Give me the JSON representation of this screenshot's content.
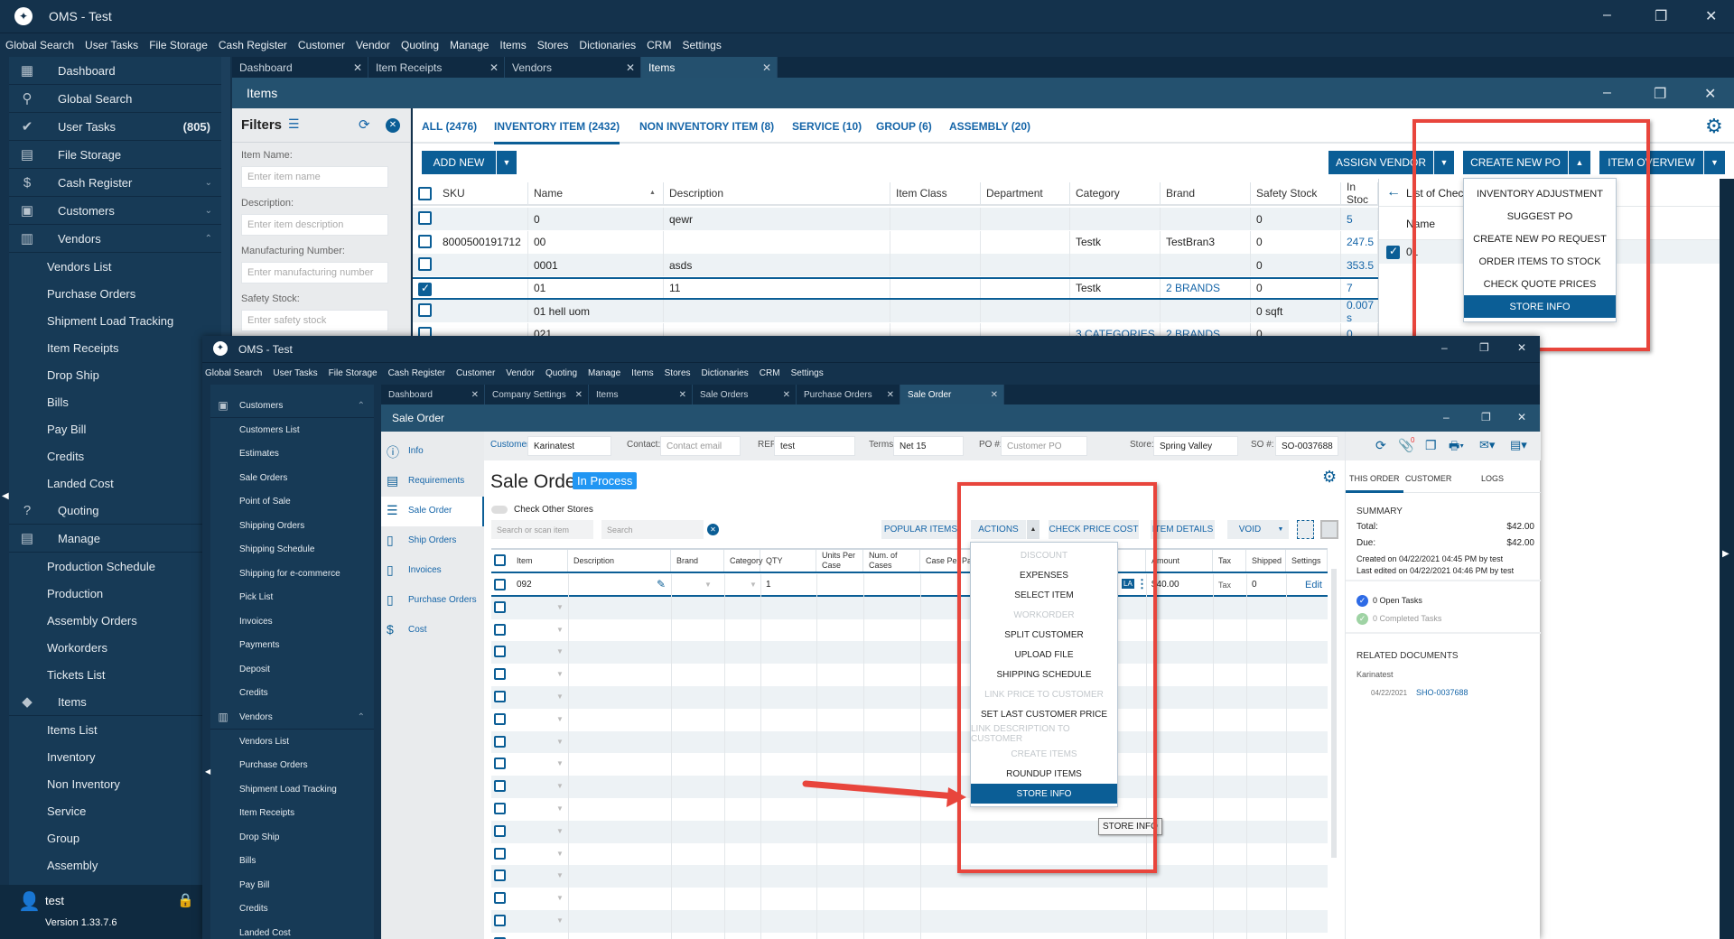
{
  "app": {
    "title": "OMS - Test"
  },
  "menu": [
    "Global Search",
    "User Tasks",
    "File Storage",
    "Cash Register",
    "Customer",
    "Vendor",
    "Quoting",
    "Manage",
    "Items",
    "Stores",
    "Dictionaries",
    "CRM",
    "Settings"
  ],
  "back": {
    "sidebar": [
      {
        "label": "Dashboard",
        "icon": "dashboard-icon",
        "glyph": "▦",
        "top": true
      },
      {
        "label": "Global Search",
        "icon": "search-icon",
        "glyph": "⚲",
        "top": true
      },
      {
        "label": "User Tasks",
        "icon": "check-circle-icon",
        "glyph": "✔",
        "top": true,
        "count": "(805)"
      },
      {
        "label": "File Storage",
        "icon": "folder-icon",
        "glyph": "▤",
        "top": true
      },
      {
        "label": "Cash Register",
        "icon": "dollar-icon",
        "glyph": "$",
        "top": true,
        "chev": "⌄"
      },
      {
        "label": "Customers",
        "icon": "person-icon",
        "glyph": "▣",
        "top": true,
        "chev": "⌄"
      },
      {
        "label": "Vendors",
        "icon": "store-icon",
        "glyph": "▥",
        "top": true,
        "chev": "⌃"
      },
      {
        "label": "Vendors List"
      },
      {
        "label": "Purchase Orders"
      },
      {
        "label": "Shipment Load Tracking"
      },
      {
        "label": "Item Receipts"
      },
      {
        "label": "Drop Ship"
      },
      {
        "label": "Bills"
      },
      {
        "label": "Pay Bill"
      },
      {
        "label": "Credits"
      },
      {
        "label": "Landed Cost"
      },
      {
        "label": "Quoting",
        "icon": "quote-icon",
        "glyph": "?",
        "top": true
      },
      {
        "label": "Manage",
        "icon": "clipboard-icon",
        "glyph": "▤",
        "top": true
      },
      {
        "label": "Production Schedule"
      },
      {
        "label": "Production"
      },
      {
        "label": "Assembly Orders"
      },
      {
        "label": "Workorders"
      },
      {
        "label": "Tickets List"
      },
      {
        "label": "Items",
        "icon": "tag-icon",
        "glyph": "◆",
        "top": true
      },
      {
        "label": "Items List"
      },
      {
        "label": "Inventory"
      },
      {
        "label": "Non Inventory"
      },
      {
        "label": "Service"
      },
      {
        "label": "Group"
      },
      {
        "label": "Assembly"
      }
    ],
    "user": {
      "name": "test",
      "version": "Version 1.33.7.6"
    },
    "tabs": [
      "Dashboard",
      "Item Receipts",
      "Vendors",
      "Items"
    ],
    "window_title": "Items",
    "filters": {
      "title": "Filters",
      "fields": [
        {
          "label": "Item Name:",
          "placeholder": "Enter item name"
        },
        {
          "label": "Description:",
          "placeholder": "Enter item description"
        },
        {
          "label": "Manufacturing Number:",
          "placeholder": "Enter manufacturing number"
        },
        {
          "label": "Safety Stock:",
          "placeholder": "Enter safety stock"
        }
      ]
    },
    "type_tabs": [
      "ALL (2476)",
      "INVENTORY ITEM (2432)",
      "NON INVENTORY ITEM (8)",
      "SERVICE (10)",
      "GROUP (6)",
      "ASSEMBLY (20)"
    ],
    "buttons": {
      "add_new": "ADD NEW",
      "assign_vendor": "ASSIGN VENDOR",
      "create_po": "CREATE NEW PO",
      "item_overview": "ITEM OVERVIEW"
    },
    "columns": [
      "SKU",
      "Name",
      "Description",
      "Item Class",
      "Department",
      "Category",
      "Brand",
      "Safety Stock",
      "In Stoc"
    ],
    "rows": [
      {
        "checked": false,
        "cells": [
          "",
          "0",
          "qewr",
          "",
          "",
          "",
          "",
          "0",
          "5"
        ]
      },
      {
        "checked": false,
        "cells": [
          "8000500191712",
          "00",
          "",
          "",
          "",
          "Testk",
          "TestBran3",
          "0",
          "247.5"
        ]
      },
      {
        "checked": false,
        "cells": [
          "",
          "0001",
          "asds",
          "",
          "",
          "",
          "",
          "0",
          "353.5"
        ]
      },
      {
        "checked": true,
        "cells": [
          "",
          "01",
          "11",
          "",
          "",
          "Testk",
          "2 BRANDS",
          "0",
          "7"
        ]
      },
      {
        "checked": false,
        "cells": [
          "",
          "01 hell uom",
          "",
          "",
          "",
          "",
          "",
          "0 sqft",
          "0.007 s"
        ]
      },
      {
        "checked": false,
        "cells": [
          "",
          "021",
          "",
          "",
          "",
          "3 CATEGORIES",
          "2 BRANDS",
          "0",
          "0"
        ]
      }
    ],
    "po_menu": [
      "INVENTORY ADJUSTMENT",
      "SUGGEST PO",
      "CREATE NEW PO REQUEST",
      "ORDER ITEMS TO STOCK",
      "CHECK QUOTE PRICES",
      "STORE INFO"
    ],
    "checklist": {
      "title": "List of Chec",
      "col": "Name",
      "row": "01"
    }
  },
  "front": {
    "sidebar": [
      {
        "label": "Customers",
        "icon": "person-icon",
        "glyph": "▣",
        "top": true,
        "chev": "⌃"
      },
      {
        "label": "Customers List"
      },
      {
        "label": "Estimates"
      },
      {
        "label": "Sale Orders"
      },
      {
        "label": "Point of Sale"
      },
      {
        "label": "Shipping Orders"
      },
      {
        "label": "Shipping Schedule"
      },
      {
        "label": "Shipping for e-commerce"
      },
      {
        "label": "Pick List"
      },
      {
        "label": "Invoices"
      },
      {
        "label": "Payments"
      },
      {
        "label": "Deposit"
      },
      {
        "label": "Credits"
      },
      {
        "label": "Vendors",
        "icon": "store-icon",
        "glyph": "▥",
        "top": true,
        "chev": "⌃"
      },
      {
        "label": "Vendors List"
      },
      {
        "label": "Purchase Orders"
      },
      {
        "label": "Shipment Load Tracking"
      },
      {
        "label": "Item Receipts"
      },
      {
        "label": "Drop Ship"
      },
      {
        "label": "Bills"
      },
      {
        "label": "Pay Bill"
      },
      {
        "label": "Credits"
      },
      {
        "label": "Landed Cost"
      }
    ],
    "tabs": [
      "Dashboard",
      "Company Settings",
      "Items",
      "Sale Orders",
      "Purchase Orders",
      "Sale Order"
    ],
    "window_title": "Sale Order",
    "nav": [
      {
        "label": "Info",
        "icon": "info-icon",
        "glyph": "ⓘ"
      },
      {
        "label": "Requirements",
        "icon": "clipboard-icon",
        "glyph": "▤"
      },
      {
        "label": "Sale Order",
        "icon": "list-icon",
        "glyph": "☰",
        "active": true
      },
      {
        "label": "Ship Orders",
        "icon": "ship-doc-icon",
        "glyph": "▯"
      },
      {
        "label": "Invoices",
        "icon": "invoice-doc-icon",
        "glyph": "▯"
      },
      {
        "label": "Purchase Orders",
        "icon": "po-doc-icon",
        "glyph": "▯"
      },
      {
        "label": "Cost",
        "icon": "dollar-icon",
        "glyph": "$"
      }
    ],
    "fields": {
      "customer_label": "Customer:",
      "customer": "Karinatest",
      "contact_label": "Contact:",
      "contact_ph": "Contact email",
      "rep_label": "REP:",
      "rep": "test",
      "terms_label": "Terms:",
      "terms": "Net 15",
      "po_label": "PO #:",
      "po_ph": "Customer PO",
      "store_label": "Store:",
      "store": "Spring Valley",
      "so_label": "SO #:",
      "so": "SO-0037688"
    },
    "attach_count": "0",
    "heading": "Sale Order",
    "status": "In Process",
    "check_other_stores": "Check Other Stores",
    "search_item_ph": "Search or scan item",
    "search_ph": "Search",
    "toolbar": {
      "popular": "POPULAR ITEMS",
      "actions": "ACTIONS",
      "check_price": "CHECK PRICE COST",
      "item_details": "ITEM DETAILS",
      "void": "VOID"
    },
    "columns": [
      "Item",
      "Description",
      "Brand",
      "Category",
      "QTY",
      "Units Per Case",
      "Num. of Cases",
      "Case Per Pallet",
      "Amount",
      "Tax",
      "Shipped",
      "Settings"
    ],
    "line": {
      "item": "092",
      "qty": "1",
      "badge": "LA",
      "amount": "$40.00",
      "tax": "Tax",
      "shipped": "0",
      "edit": "Edit"
    },
    "actions_menu": [
      {
        "label": "DISCOUNT",
        "disabled": true
      },
      {
        "label": "EXPENSES"
      },
      {
        "label": "SELECT ITEM"
      },
      {
        "label": "WORKORDER",
        "disabled": true
      },
      {
        "label": "SPLIT CUSTOMER"
      },
      {
        "label": "UPLOAD FILE"
      },
      {
        "label": "SHIPPING SCHEDULE"
      },
      {
        "label": "LINK PRICE TO CUSTOMER",
        "disabled": true
      },
      {
        "label": "SET LAST CUSTOMER PRICE"
      },
      {
        "label": "LINK DESCRIPTION TO CUSTOMER",
        "disabled": true
      },
      {
        "label": "CREATE ITEMS",
        "disabled": true
      },
      {
        "label": "ROUNDUP ITEMS"
      },
      {
        "label": "STORE INFO",
        "selected": true
      }
    ],
    "tooltip": "STORE INFO",
    "right": {
      "tabs": [
        "THIS ORDER",
        "CUSTOMER",
        "LOGS"
      ],
      "summary": "SUMMARY",
      "total_label": "Total:",
      "total": "$42.00",
      "due_label": "Due:",
      "due": "$42.00",
      "created": "Created on 04/22/2021 04:45 PM by test",
      "edited": "Last edited on 04/22/2021 04:46 PM by test",
      "open_tasks": "0 Open Tasks",
      "completed_tasks": "0 Completed Tasks",
      "related": "RELATED DOCUMENTS",
      "related_customer": "Karinatest",
      "related_date": "04/22/2021",
      "related_doc": "SHO-0037688"
    }
  },
  "colors": {
    "accent": "#0b5e96",
    "highlight": "#e8453c",
    "status": "#2196f3"
  }
}
